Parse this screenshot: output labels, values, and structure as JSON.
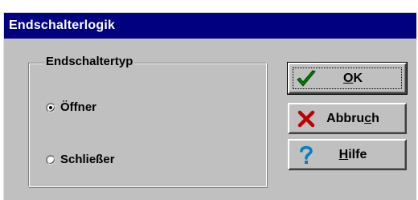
{
  "window": {
    "title": "Endschalterlogik"
  },
  "group": {
    "label": "Endschaltertyp",
    "options": [
      {
        "label": "Öffner",
        "selected": true
      },
      {
        "label": "Schließer",
        "selected": false
      }
    ]
  },
  "buttons": {
    "ok": {
      "label": "OK",
      "underline": "O",
      "rest": "K",
      "icon": "check-icon"
    },
    "cancel": {
      "label": "Abbruch",
      "prefix": "Abbru",
      "underline": "c",
      "suffix": "h",
      "icon": "red-x-icon"
    },
    "help": {
      "label": "Hilfe",
      "underline": "H",
      "rest": "ilfe",
      "icon": "question-icon"
    }
  },
  "colors": {
    "titlebar": "#000080",
    "face": "#c0c0c0",
    "check": "#008000",
    "cross": "#c00000",
    "question": "#0080c0"
  }
}
